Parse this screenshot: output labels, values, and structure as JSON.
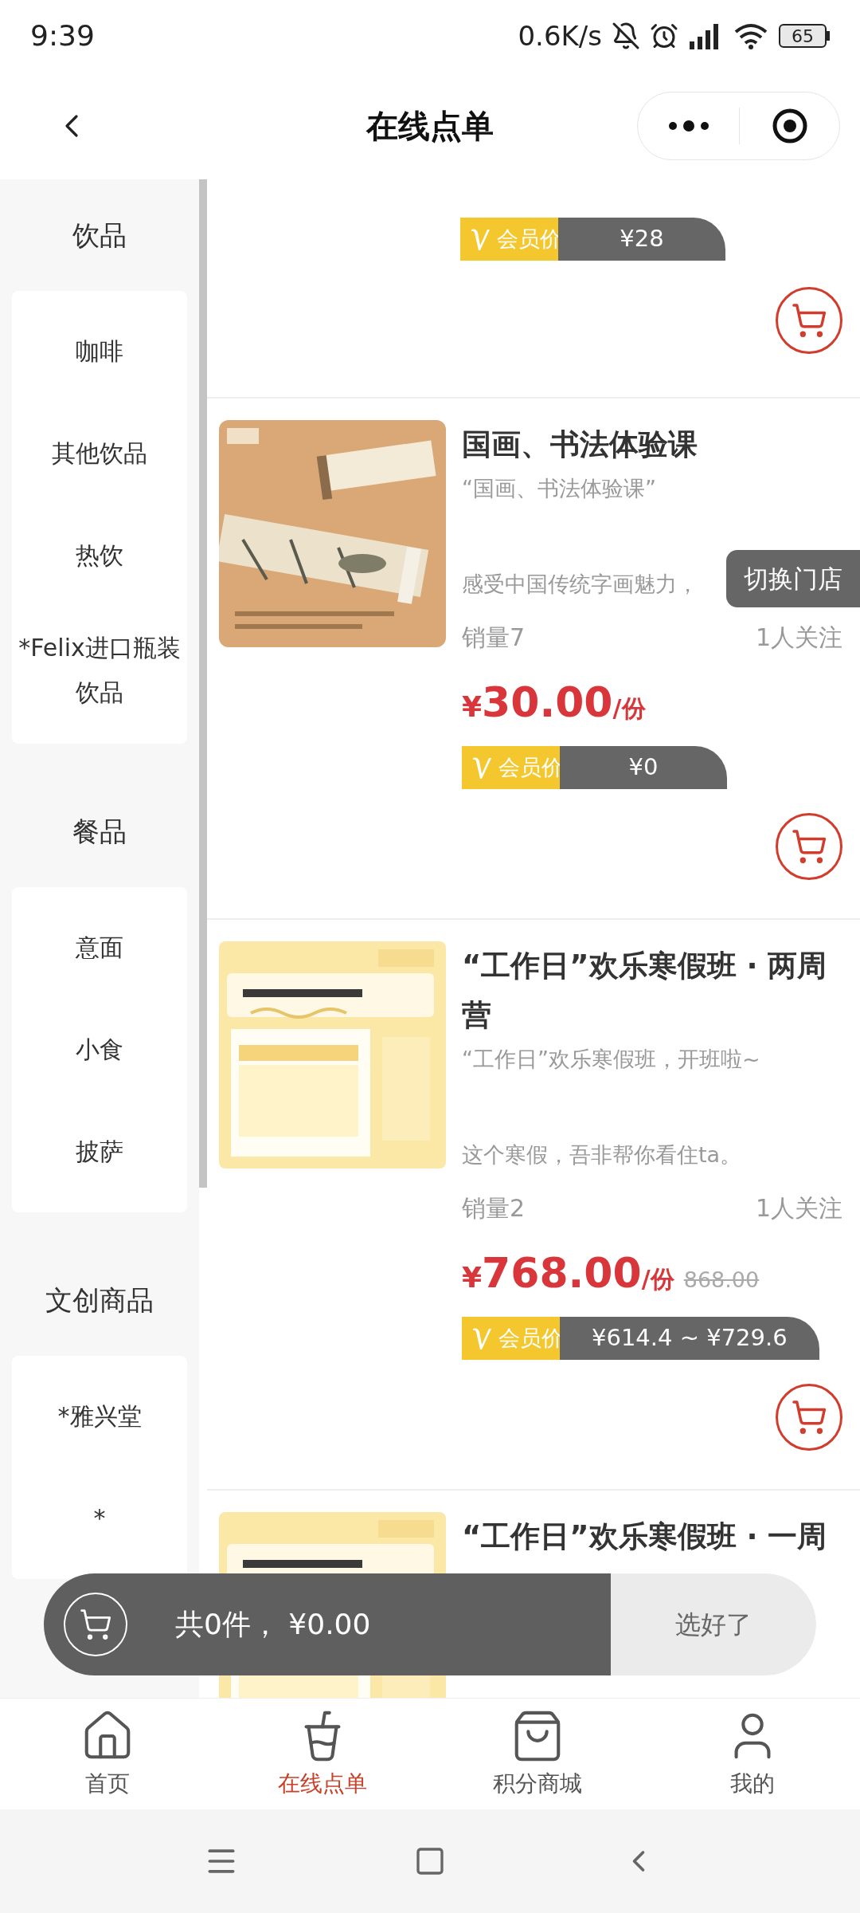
{
  "status_bar": {
    "time": "9:39",
    "speed": "0.6K/s",
    "battery": "65"
  },
  "header": {
    "title": "在线点单"
  },
  "sidebar": {
    "groups": [
      {
        "title": "饮品",
        "items": [
          {
            "label": "咖啡"
          },
          {
            "label": "其他饮品"
          },
          {
            "label": "热饮"
          },
          {
            "label": "*Felix进口瓶装饮品"
          }
        ]
      },
      {
        "title": "餐品",
        "items": [
          {
            "label": "意面"
          },
          {
            "label": "小食"
          },
          {
            "label": "披萨"
          }
        ]
      },
      {
        "title": "文创商品",
        "items": [
          {
            "label": "*雅兴堂"
          },
          {
            "label": "*"
          }
        ]
      }
    ]
  },
  "products": [
    {
      "kind": "partial",
      "member_label": "会员价",
      "member_price": "¥28"
    },
    {
      "kind": "full",
      "title": "国画、书法体验课",
      "subtitle": "“国画、书法体验课”",
      "desc": "感受中国传统字画魅力，",
      "sales": "销量7",
      "followers": "1人关注",
      "price": "¥30.00",
      "unit": "/份",
      "member_label": "会员价",
      "member_price": "¥0"
    },
    {
      "kind": "full",
      "title": "“工作日”欢乐寒假班 · 两周营",
      "subtitle": "“工作日”欢乐寒假班，开班啦~",
      "desc": "这个寒假，吾非帮你看住ta。",
      "sales": "销量2",
      "followers": "1人关注",
      "price": "¥768.00",
      "unit": "/份",
      "original_price": "868.00",
      "member_label": "会员价",
      "member_price": "¥614.4 ~ ¥729.6"
    },
    {
      "kind": "top",
      "title": "“工作日”欢乐寒假班 · 一周"
    }
  ],
  "store_switch": "切换门店",
  "cart_bar": {
    "summary": "共0件， ¥0.00",
    "button": "选好了"
  },
  "tabs": [
    {
      "label": "首页",
      "selected": false
    },
    {
      "label": "在线点单",
      "selected": true
    },
    {
      "label": "积分商城",
      "selected": false
    },
    {
      "label": "我的",
      "selected": false
    }
  ]
}
